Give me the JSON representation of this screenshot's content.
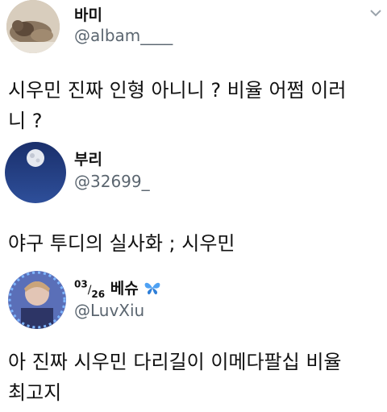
{
  "tweets": [
    {
      "name": "바미",
      "handle": "@albam____",
      "text": "시우민 진짜 인형 아니니 ? 비율 어쩜 이러\n니 ?"
    },
    {
      "name": "부리",
      "handle": "@32699_",
      "text": "야구 투디의 실사화 ; 시우민"
    },
    {
      "name_date_top": "03",
      "name_slash": "/",
      "name_date_bottom": "26",
      "name_text": "베슈",
      "name_emoji": "butterfly-icon",
      "handle": "@LuvXiu",
      "text": "아 진짜 시우민 다리길이 이메다팔십 비율\n최고지"
    }
  ],
  "colors": {
    "handle": "#5b6670",
    "text": "#111111",
    "butterfly": "#3b82f6"
  }
}
